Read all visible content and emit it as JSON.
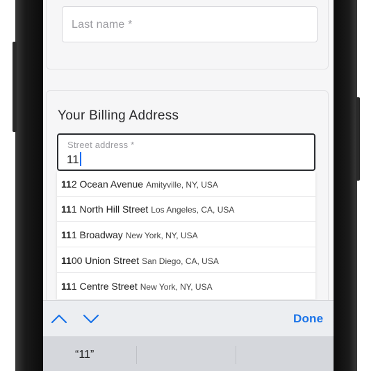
{
  "form": {
    "last_name_placeholder": "Last name *",
    "billing_title": "Your Billing Address",
    "street_label": "Street address *",
    "street_value": "11"
  },
  "suggestions": [
    {
      "match": "11",
      "rest": "2 Ocean Avenue",
      "secondary": "Amityville, NY, USA"
    },
    {
      "match": "11",
      "rest": "1 North Hill Street",
      "secondary": "Los Angeles, CA, USA"
    },
    {
      "match": "11",
      "rest": "1 Broadway",
      "secondary": "New York, NY, USA"
    },
    {
      "match": "11",
      "rest": "00 Union Street",
      "secondary": "San Diego, CA, USA"
    },
    {
      "match": "11",
      "rest": "1 Centre Street",
      "secondary": "New York, NY, USA"
    }
  ],
  "keyboard": {
    "done_label": "Done",
    "predictive": [
      "“11”",
      "",
      ""
    ]
  },
  "colors": {
    "accent": "#1a73e8",
    "caret": "#1c6ef3"
  }
}
